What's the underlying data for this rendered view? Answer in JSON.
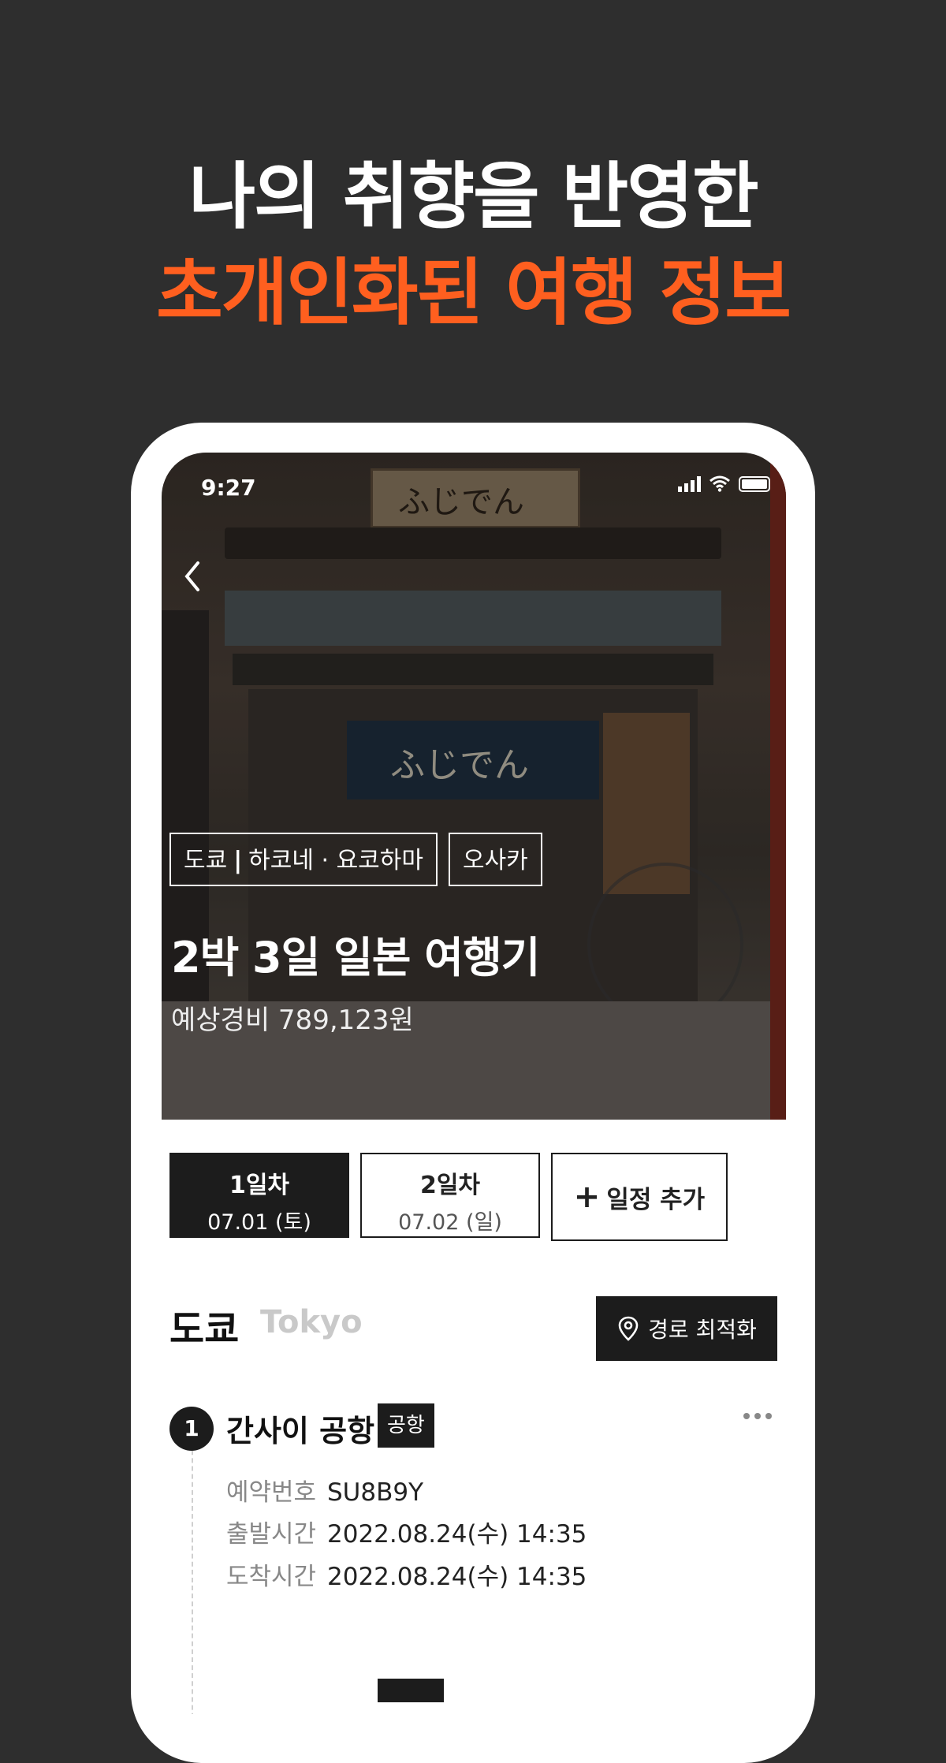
{
  "headline": {
    "line1": "나의 취향을 반영한",
    "line2": "초개인화된 여행 정보"
  },
  "colors": {
    "accent": "#ff5f1f",
    "background": "#2e2e2e",
    "dark": "#1c1c1c"
  },
  "status_bar": {
    "time": "9:27"
  },
  "hero": {
    "sign_text": "ふじでん",
    "tags": [
      {
        "city": "도쿄",
        "divider": "|",
        "rest": "하코네 · 요코하마"
      },
      {
        "city": "오사카"
      }
    ],
    "title": "2박 3일 일본 여행기",
    "cost": "예상경비 789,123원"
  },
  "day_tabs": [
    {
      "label": "1일차",
      "date": "07.01 (토)",
      "active": true
    },
    {
      "label": "2일차",
      "date": "07.02 (일)",
      "active": false
    }
  ],
  "add_day": {
    "label": "일정 추가",
    "icon": "plus-icon"
  },
  "section": {
    "city_ko": "도쿄",
    "city_en": "Tokyo",
    "optimize_label": "경로 최적화",
    "optimize_icon": "map-pin-icon"
  },
  "itinerary": [
    {
      "number": "1",
      "name": "간사이 공항",
      "badge": "공항",
      "details": [
        {
          "key": "예약번호",
          "value": "SU8B9Y"
        },
        {
          "key": "출발시간",
          "value": "2022.08.24(수) 14:35"
        },
        {
          "key": "도착시간",
          "value": "2022.08.24(수) 14:35"
        }
      ]
    }
  ]
}
